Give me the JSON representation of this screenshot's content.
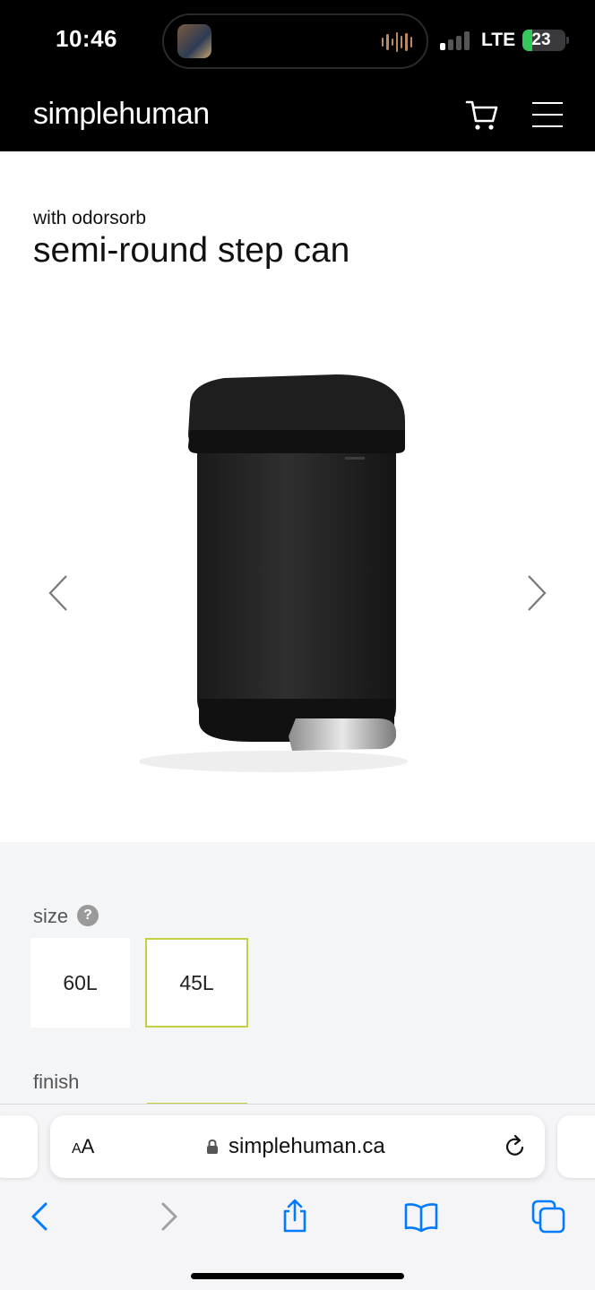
{
  "status_bar": {
    "time": "10:46",
    "carrier": "LTE",
    "battery_level": "23",
    "battery_fraction": 0.23,
    "battery_color": "#34c759"
  },
  "header": {
    "logo": "simplehuman",
    "icons": [
      "cart-icon",
      "menu-icon"
    ],
    "background": "#000000"
  },
  "product": {
    "subtitle": "with odorsorb",
    "title": "semi-round step can",
    "gallery_icons": [
      "chevron-left-icon",
      "chevron-right-icon"
    ]
  },
  "options": {
    "size_label": "size",
    "help_glyph": "?",
    "sizes": [
      {
        "label": "60L",
        "selected": false
      },
      {
        "label": "45L",
        "selected": true
      }
    ],
    "finish_label": "finish",
    "accent": "#c6cf3f",
    "background": "#f4f5f7"
  },
  "browser": {
    "aa_label": "AA",
    "url": "simplehuman.ca",
    "toolbar_icons": [
      "back-icon",
      "forward-icon",
      "share-icon",
      "bookmarks-icon",
      "tabs-icon"
    ],
    "accent": "#007aff"
  }
}
